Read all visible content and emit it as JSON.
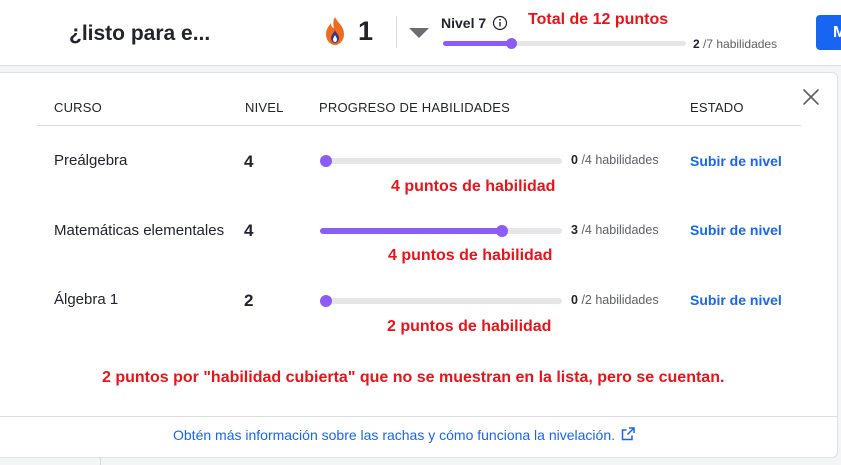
{
  "header": {
    "title": "¿listo para e...",
    "streak_count": "1",
    "level_label": "Nivel 7",
    "level_progress": 0.28,
    "level_count_value": "2",
    "level_count_rest": "/7 habilidades",
    "cta_label": "M",
    "icons": [
      "flame-icon",
      "caret-down-icon",
      "info-icon"
    ]
  },
  "annotations": {
    "total": "Total de 12 puntos",
    "rows": [
      "4 puntos de habilidad",
      "4 puntos de habilidad",
      "2 puntos de habilidad"
    ],
    "note": "2 puntos por \"habilidad cubierta\" que no se muestran en la lista, pero se cuentan."
  },
  "table": {
    "headers": [
      "CURSO",
      "NIVEL",
      "PROGRESO DE HABILIDADES",
      "ESTADO"
    ],
    "rows": [
      {
        "course": "Preálgebra",
        "level": "4",
        "progress": 0,
        "count_value": "0",
        "count_rest": "/4 habilidades",
        "action": "Subir de nivel"
      },
      {
        "course": "Matemáticas elementales",
        "level": "4",
        "progress": 0.75,
        "count_value": "3",
        "count_rest": "/4 habilidades",
        "action": "Subir de nivel"
      },
      {
        "course": "Álgebra 1",
        "level": "2",
        "progress": 0,
        "count_value": "0",
        "count_rest": "/2 habilidades",
        "action": "Subir de nivel"
      }
    ]
  },
  "footer": {
    "learn_more": "Obtén más información sobre las rachas y cómo funciona la nivelación."
  },
  "colors": {
    "accent": "#8b5cf6",
    "link": "#1865f2",
    "annotation": "#e8141a",
    "flame": "#f26b1d"
  }
}
